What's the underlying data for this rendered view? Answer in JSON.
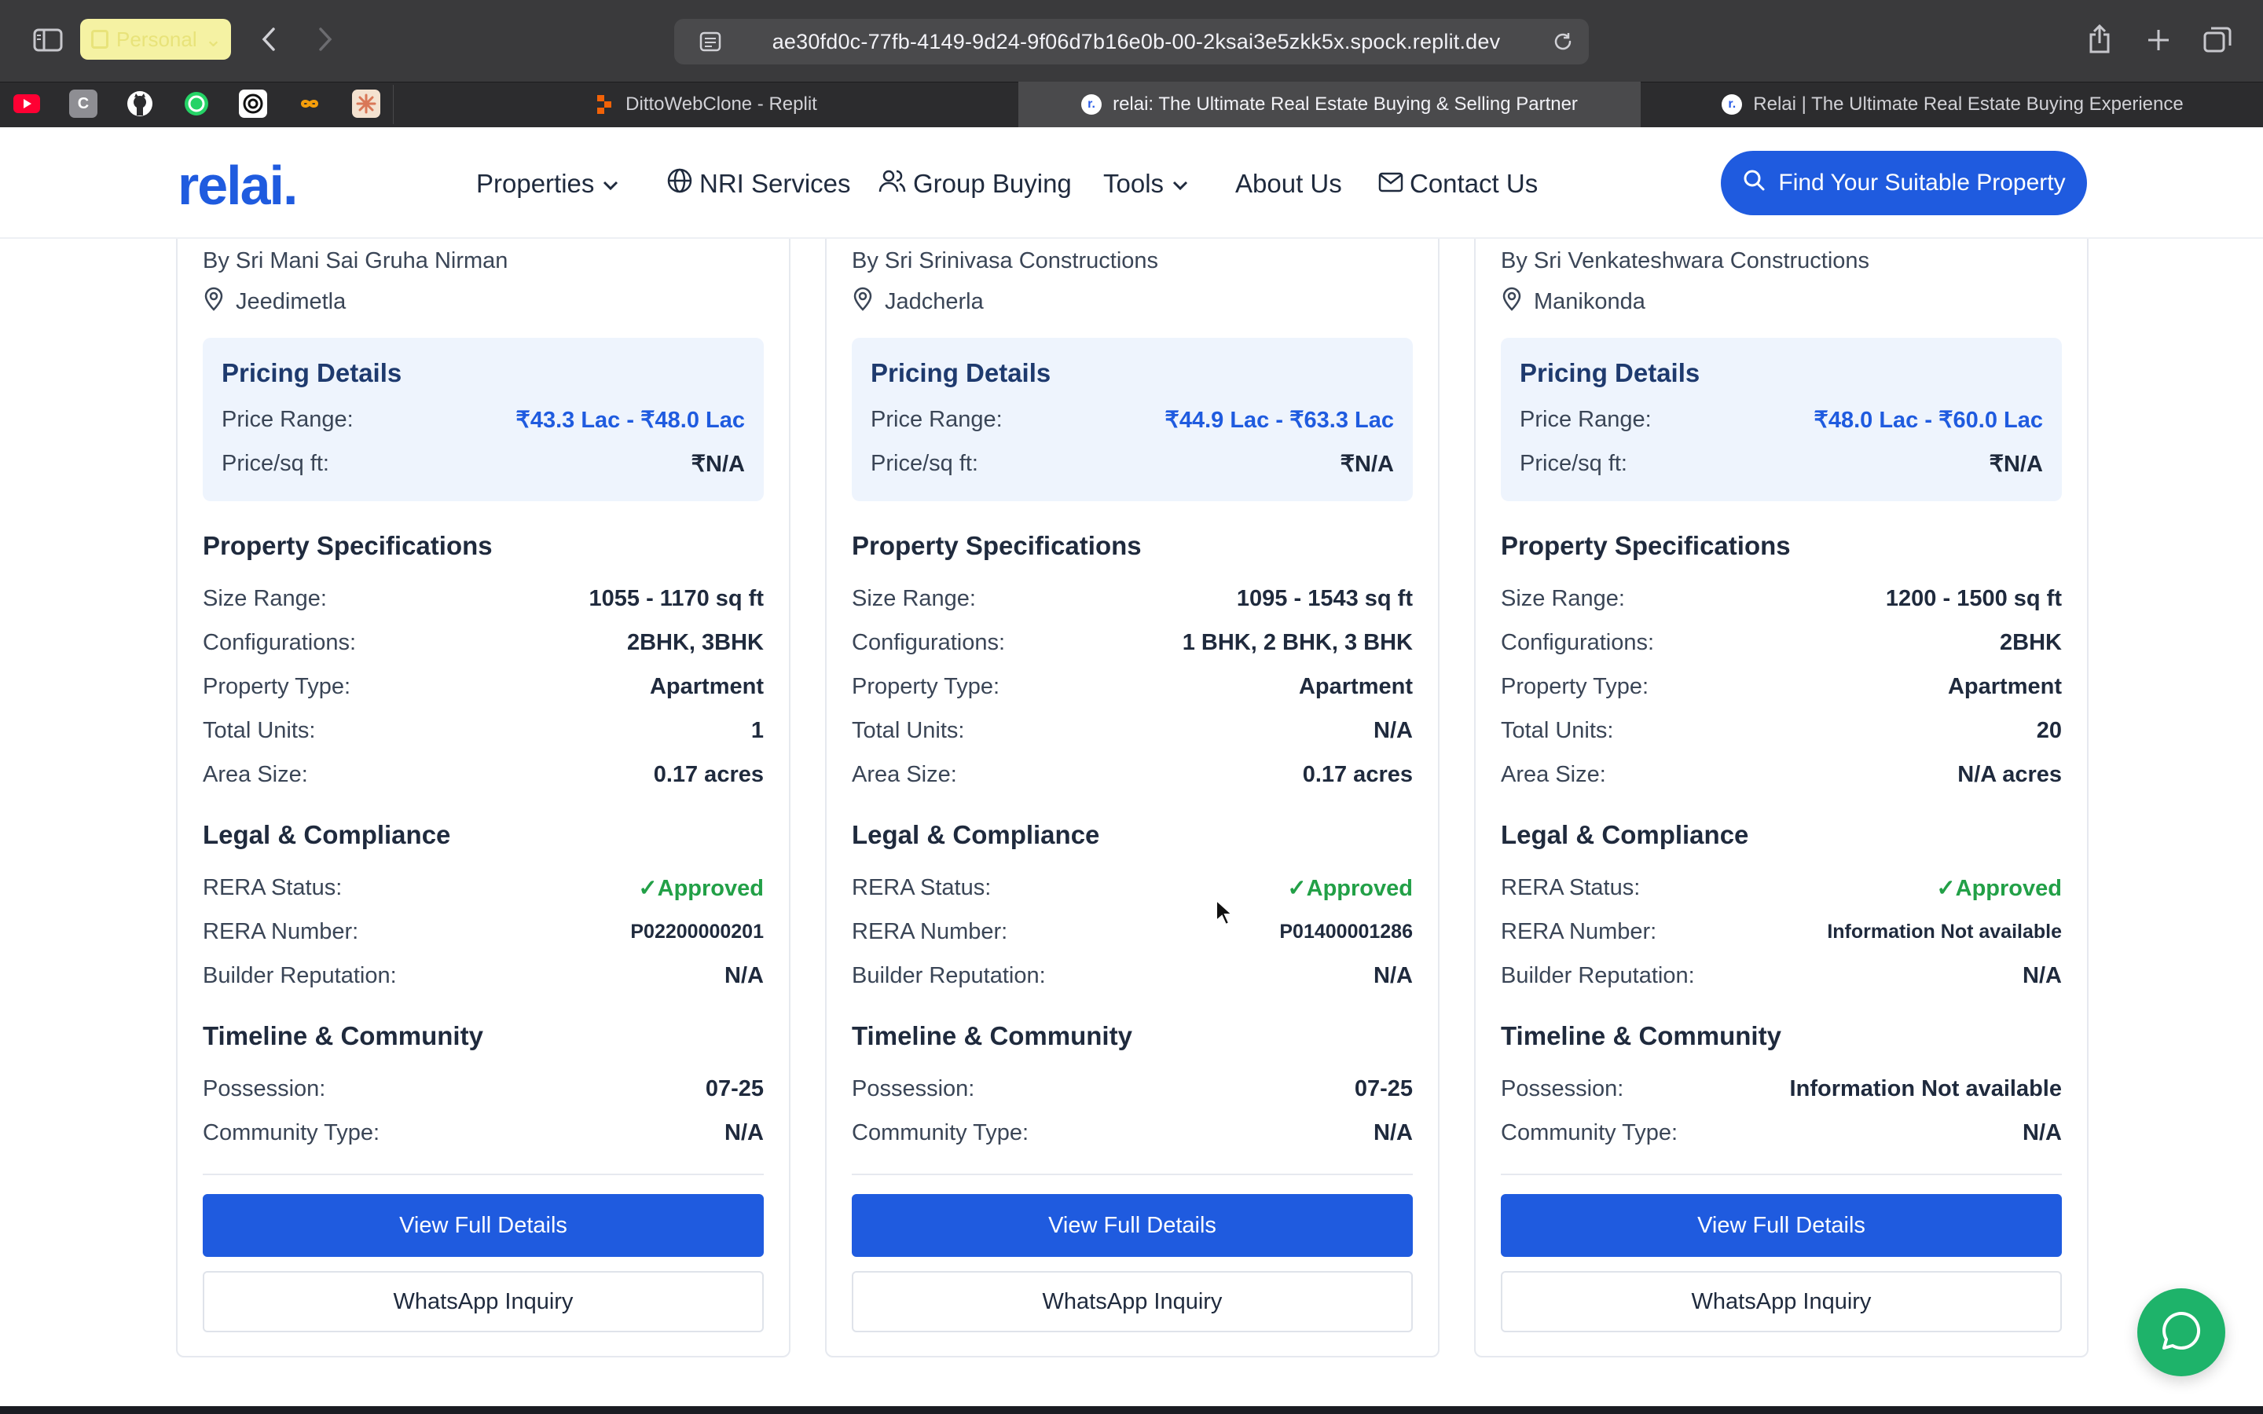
{
  "browser": {
    "profile_label": "Personal",
    "url": "ae30fd0c-77fb-4149-9d24-9f06d7b16e0b-00-2ksai3e5zkk5x.spock.replit.dev",
    "tabs": [
      {
        "title": "DittoWebClone - Replit"
      },
      {
        "title": "relai: The Ultimate Real Estate Buying & Selling Partner"
      },
      {
        "title": "Relai | The Ultimate Real Estate Buying Experience"
      }
    ]
  },
  "header": {
    "logo": "relai.",
    "nav": [
      {
        "label": "Properties"
      },
      {
        "label": "NRI Services"
      },
      {
        "label": "Group Buying"
      },
      {
        "label": "Tools"
      },
      {
        "label": "About Us"
      },
      {
        "label": "Contact Us"
      }
    ],
    "cta_label": "Find Your Suitable Property"
  },
  "labels": {
    "pricing_title": "Pricing Details",
    "price_range": "Price Range:",
    "price_sqft": "Price/sq ft:",
    "specs_title": "Property Specifications",
    "size_range": "Size Range:",
    "configurations": "Configurations:",
    "property_type": "Property Type:",
    "total_units": "Total Units:",
    "area_size": "Area Size:",
    "legal_title": "Legal & Compliance",
    "rera_status": "RERA Status:",
    "rera_number": "RERA Number:",
    "builder_reputation": "Builder Reputation:",
    "timeline_title": "Timeline & Community",
    "possession": "Possession:",
    "community_type": "Community Type:",
    "view_details": "View Full Details",
    "whatsapp": "WhatsApp Inquiry"
  },
  "cards": [
    {
      "builder": "By Sri Mani Sai Gruha Nirman",
      "location": "Jeedimetla",
      "price_range": "₹43.3 Lac - ₹48.0 Lac",
      "price_sqft": "₹N/A",
      "size_range": "1055 - 1170 sq ft",
      "configurations": "2BHK, 3BHK",
      "property_type": "Apartment",
      "total_units": "1",
      "area_size": "0.17 acres",
      "rera_status": "✓Approved",
      "rera_number": "P02200000201",
      "builder_reputation": "N/A",
      "possession": "07-25",
      "community_type": "N/A"
    },
    {
      "builder": "By Sri Srinivasa Constructions",
      "location": "Jadcherla",
      "price_range": "₹44.9 Lac - ₹63.3 Lac",
      "price_sqft": "₹N/A",
      "size_range": "1095 - 1543 sq ft",
      "configurations": "1 BHK, 2 BHK, 3 BHK",
      "property_type": "Apartment",
      "total_units": "N/A",
      "area_size": "0.17 acres",
      "rera_status": "✓Approved",
      "rera_number": "P01400001286",
      "builder_reputation": "N/A",
      "possession": "07-25",
      "community_type": "N/A"
    },
    {
      "builder": "By Sri Venkateshwara Constructions",
      "location": "Manikonda",
      "price_range": "₹48.0 Lac - ₹60.0 Lac",
      "price_sqft": "₹N/A",
      "size_range": "1200 - 1500 sq ft",
      "configurations": "2BHK",
      "property_type": "Apartment",
      "total_units": "20",
      "area_size": "N/A acres",
      "rera_status": "✓Approved",
      "rera_number": "Information Not available",
      "builder_reputation": "N/A",
      "possession": "Information Not available",
      "community_type": "N/A"
    }
  ],
  "colors": {
    "brand": "#1f5bdf",
    "approved": "#22a047",
    "whatsapp": "#1eb36a"
  }
}
